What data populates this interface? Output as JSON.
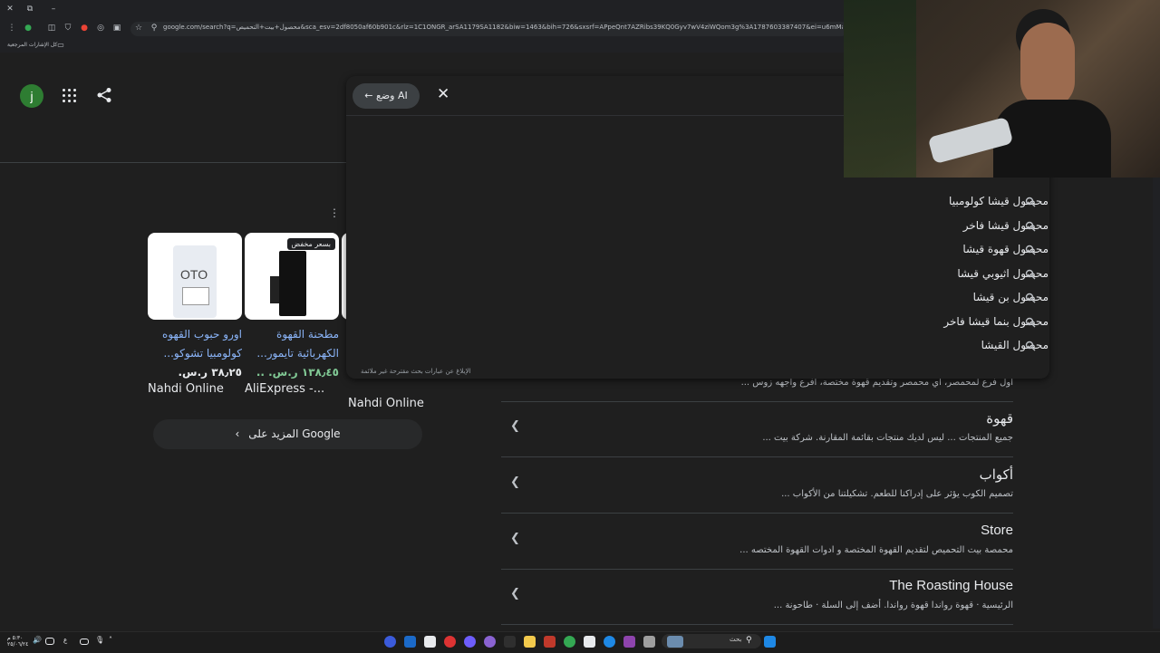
{
  "browser": {
    "url": "google.com/search?q=محصول+بيت+التحميص&sca_esv=2df8050af60b901c&rlz=1C1ONGR_arSA1179SA1182&biw=1463&bih=726&sxsrf=APpeQnt7AZRibs39KQ0Gyv7wV4ziWQom3g%3A1787603387407&ei=u6mMauSwGleO9u8PI-ms-AM&uact=5&oq",
    "bookmarks_label": "كل الإشارات المرجعية"
  },
  "header": {
    "avatar_letter": "j",
    "avatar_color": "#2e7d32"
  },
  "products": [
    {
      "badge": "",
      "title_line1": "اورو حبوب القهوه",
      "title_line2": "كولومبيا تشوكو...",
      "price": "٣٨٫٢٥ ر.س.",
      "store": "Nahdi Online",
      "label": "OTO"
    },
    {
      "badge": "بسعر مخفض",
      "title_line1": "مطحنة القهوة",
      "title_line2": "الكهربائية تايمور...",
      "price": "١٣٨٫٤٥ ر.س. ..",
      "store": "AliExpress -...",
      "label": ""
    },
    {
      "badge": "",
      "title_line1": "",
      "title_line2": "",
      "price": "",
      "store": "Nahdi Online",
      "label": ""
    }
  ],
  "more_button": "المزيد على Google",
  "results": [
    {
      "title": "",
      "snippet": "اول فرع لمحمصر، اي محمصر وتقديم قهوة مختصة، افرع واجهه زوس ..."
    },
    {
      "title": "قهوة",
      "snippet": "جميع المنتجات ... ليس لديك منتجات بقائمة المقارنة. شركة بيت ..."
    },
    {
      "title": "أكواب",
      "snippet": "تصميم الكوب يؤثر على إدراكنا للطعم. تشكيلتنا من الأكواب ..."
    },
    {
      "title": "Store",
      "snippet": "محمصة بيت التحميص لتقديم القهوة المختصة و ادوات القهوة المختصه ..."
    },
    {
      "title": "The Roasting House",
      "snippet": "الرئيسية · قهوة رواندا قهوة رواندا. أضف إلى السلة · طاحونة ..."
    }
  ],
  "ai_overlay": {
    "mode_label": "وضع AI",
    "suggestions": [
      "محصول قيشا كولومبيا",
      "محصول قيشا فاخر",
      "محصول قهوة قيشا",
      "محصول اثيوبي قيشا",
      "محصول بن قيشا",
      "محصول بنما قيشا فاخر",
      "محصول القيشا"
    ],
    "report_text": "الإبلاغ عن عبارات بحث مقترحة غير ملائمة"
  },
  "taskbar": {
    "search_label": "بحث",
    "clock_time": "٥:٣٠ م",
    "clock_date": "٢٥/٠٦/٢٤",
    "lang": "ع"
  }
}
